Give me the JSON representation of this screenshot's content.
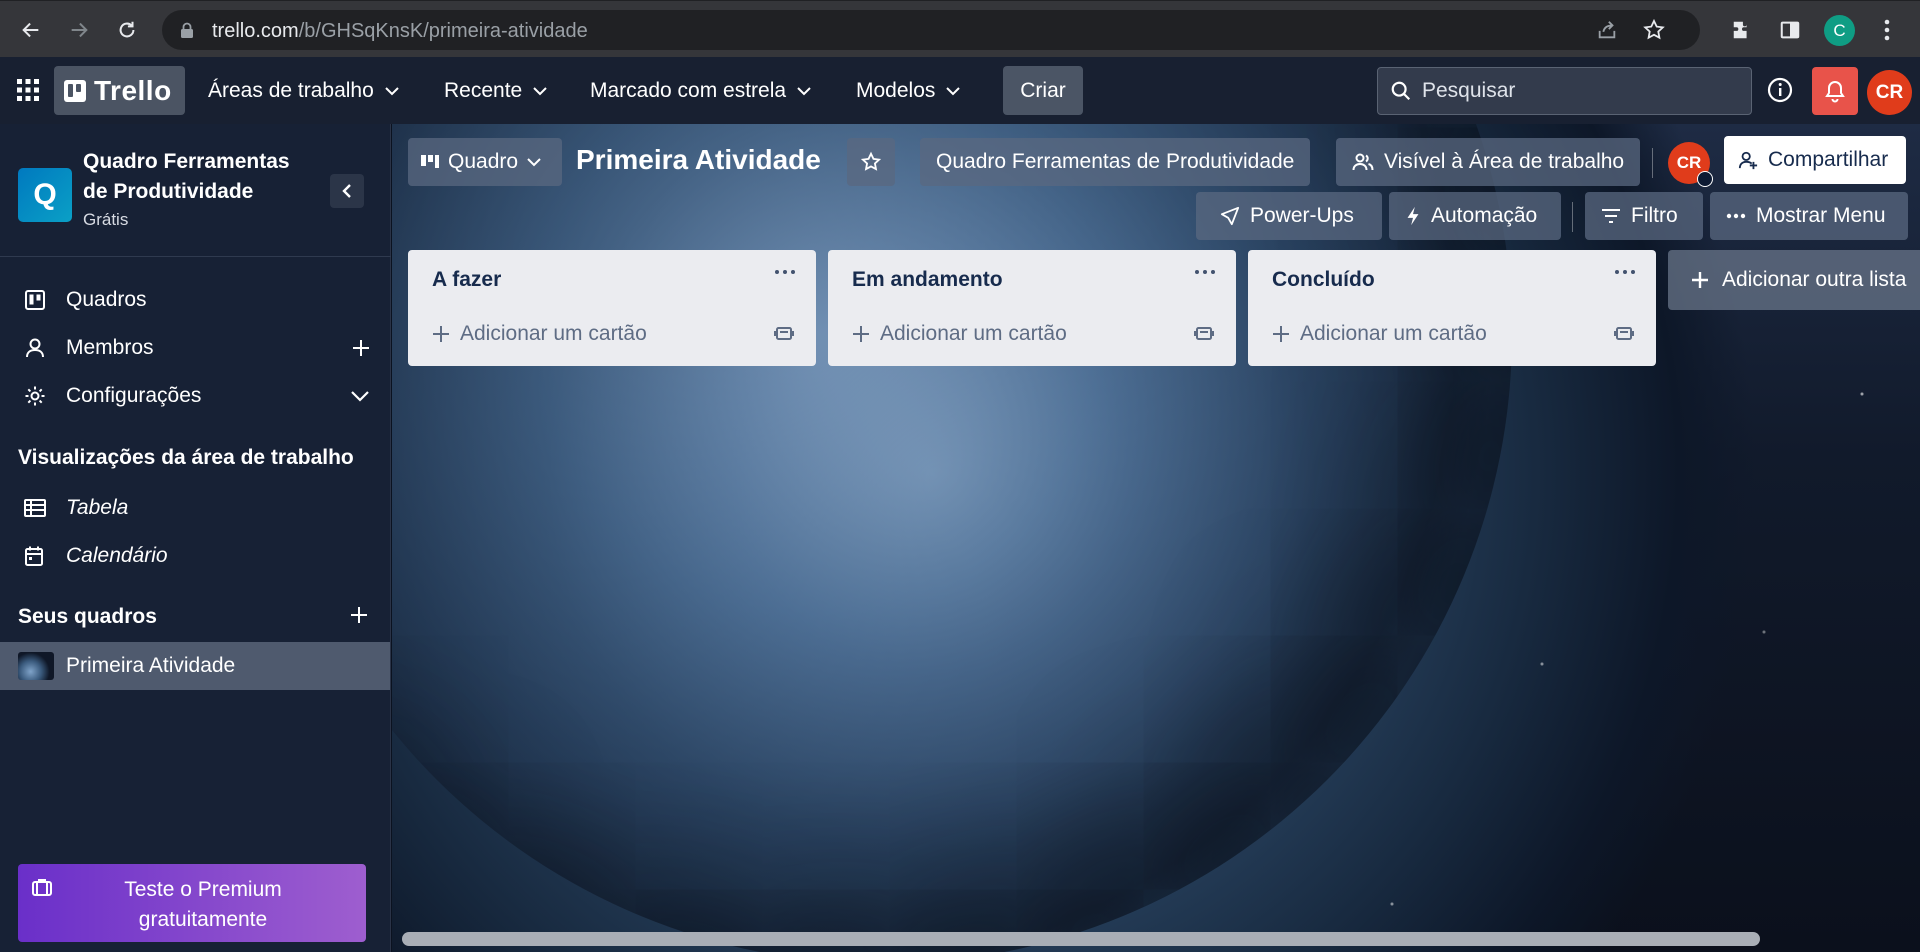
{
  "browser": {
    "url_host": "trello.com",
    "url_path": "/b/GHSqKnsK/primeira-atividade",
    "profile_initial": "C"
  },
  "header": {
    "logo_text": "Trello",
    "nav": [
      {
        "label": "Áreas de trabalho"
      },
      {
        "label": "Recente"
      },
      {
        "label": "Marcado com estrela"
      },
      {
        "label": "Modelos"
      }
    ],
    "create_label": "Criar",
    "search_placeholder": "Pesquisar",
    "avatar_initials": "CR",
    "accent_color": "#e8534a"
  },
  "sidebar": {
    "workspace_initial": "Q",
    "workspace_name": "Quadro Ferramentas de Produtividade",
    "workspace_plan": "Grátis",
    "items": [
      {
        "label": "Quadros",
        "icon": "board-icon"
      },
      {
        "label": "Membros",
        "icon": "person-icon"
      },
      {
        "label": "Configurações",
        "icon": "gear-icon"
      }
    ],
    "views_title": "Visualizações da área de trabalho",
    "views": [
      {
        "label": "Tabela",
        "icon": "table-icon"
      },
      {
        "label": "Calendário",
        "icon": "calendar-icon"
      }
    ],
    "boards_title": "Seus quadros",
    "boards": [
      {
        "label": "Primeira Atividade"
      }
    ],
    "premium_label": "Teste o Premium gratuitamente"
  },
  "board": {
    "view_label": "Quadro",
    "title": "Primeira Atividade",
    "workspace_button": "Quadro Ferramentas de Produtividade",
    "visibility_button": "Visível à Área de trabalho",
    "member_initials": "CR",
    "share_label": "Compartilhar",
    "powerups_label": "Power-Ups",
    "automation_label": "Automação",
    "filter_label": "Filtro",
    "menu_label": "Mostrar Menu",
    "add_card_label": "Adicionar um cartão",
    "add_list_label": "Adicionar outra lista",
    "lists": [
      {
        "title": "A fazer"
      },
      {
        "title": "Em andamento"
      },
      {
        "title": "Concluído"
      }
    ]
  }
}
